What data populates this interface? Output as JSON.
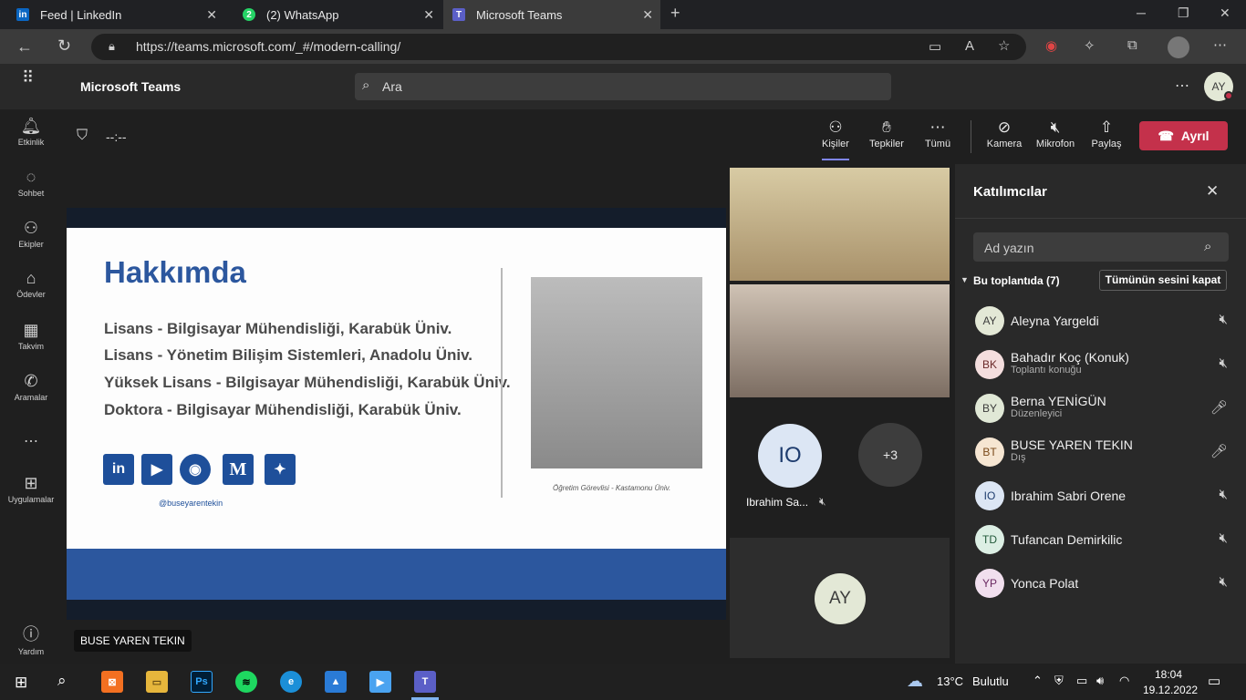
{
  "browser": {
    "tabs": [
      {
        "title": "Feed | LinkedIn",
        "icon": "linkedin-icon"
      },
      {
        "title": "(2) WhatsApp",
        "icon": "whatsapp-icon"
      },
      {
        "title": "Microsoft Teams",
        "icon": "teams-icon"
      }
    ],
    "url": "https://teams.microsoft.com/_#/modern-calling/"
  },
  "teams": {
    "app_title": "Microsoft Teams",
    "search_placeholder": "Ara",
    "user_initials": "AY"
  },
  "rail": [
    {
      "label": "Etkinlik",
      "icon": "bell-icon"
    },
    {
      "label": "Sohbet",
      "icon": "chat-icon"
    },
    {
      "label": "Ekipler",
      "icon": "teams-group-icon"
    },
    {
      "label": "Ödevler",
      "icon": "backpack-icon"
    },
    {
      "label": "Takvim",
      "icon": "calendar-icon"
    },
    {
      "label": "Aramalar",
      "icon": "phone-icon"
    },
    {
      "label": "Uygulamalar",
      "icon": "apps-icon"
    },
    {
      "label": "Yardım",
      "icon": "help-icon"
    }
  ],
  "call": {
    "timer": "--:--",
    "buttons": {
      "people": "Kişiler",
      "reactions": "Tepkiler",
      "more": "Tümü",
      "camera": "Kamera",
      "mic": "Mikrofon",
      "share": "Paylaş",
      "leave": "Ayrıl"
    },
    "presenter_label": "BUSE YAREN TEKIN"
  },
  "slide": {
    "heading": "Hakkımda",
    "lines": [
      "Lisans - Bilgisayar Mühendisliği, Karabük Üniv.",
      "Lisans - Yönetim Bilişim Sistemleri, Anadolu Üniv.",
      "Yüksek Lisans - Bilgisayar Mühendisliği, Karabük Üniv.",
      "Doktora - Bilgisayar Mühendisliği, Karabük Üniv."
    ],
    "social_icons": [
      "linkedin-icon",
      "youtube-icon",
      "github-icon",
      "medium-icon",
      "twitter-icon"
    ],
    "handle": "@buseyarentekin",
    "caption": "Öğretim Görevlisi - Kastamonu Üniv."
  },
  "videos": {
    "tile_io_initials": "IO",
    "tile_io_name": "Ibrahim Sa...",
    "more_count": "+3",
    "self_initials": "AY"
  },
  "participants": {
    "title": "Katılımcılar",
    "search_placeholder": "Ad yazın",
    "section": "Bu toplantıda (7)",
    "mute_all": "Tümünün sesini kapat",
    "list": [
      {
        "initials": "AY",
        "name": "Aleyna Yargeldi",
        "role": "",
        "mic": "muted",
        "color": "#e3e8d6",
        "text": "#3c3c3c"
      },
      {
        "initials": "BK",
        "name": "Bahadır Koç (Konuk)",
        "role": "Toplantı konuğu",
        "mic": "muted",
        "color": "#f4dede",
        "text": "#6b2a2a"
      },
      {
        "initials": "BY",
        "name": "Berna YENİGÜN",
        "role": "Düzenleyici",
        "mic": "on",
        "color": "#e0e8d6",
        "text": "#3c3c3c"
      },
      {
        "initials": "BT",
        "name": "BUSE YAREN TEKIN",
        "role": "Dış",
        "mic": "on",
        "color": "#f6e6d2",
        "text": "#7a4a1a"
      },
      {
        "initials": "IO",
        "name": "Ibrahim Sabri Orene",
        "role": "",
        "mic": "muted",
        "color": "#dce6f4",
        "text": "#1e3c6e"
      },
      {
        "initials": "TD",
        "name": "Tufancan Demirkilic",
        "role": "",
        "mic": "muted",
        "color": "#dcefe4",
        "text": "#225a3a"
      },
      {
        "initials": "YP",
        "name": "Yonca Polat",
        "role": "",
        "mic": "muted",
        "color": "#f1dfee",
        "text": "#6b2a62"
      }
    ]
  },
  "taskbar": {
    "weather_temp": "13°C",
    "weather_text": "Bulutlu",
    "time": "18:04",
    "date": "19.12.2022"
  }
}
